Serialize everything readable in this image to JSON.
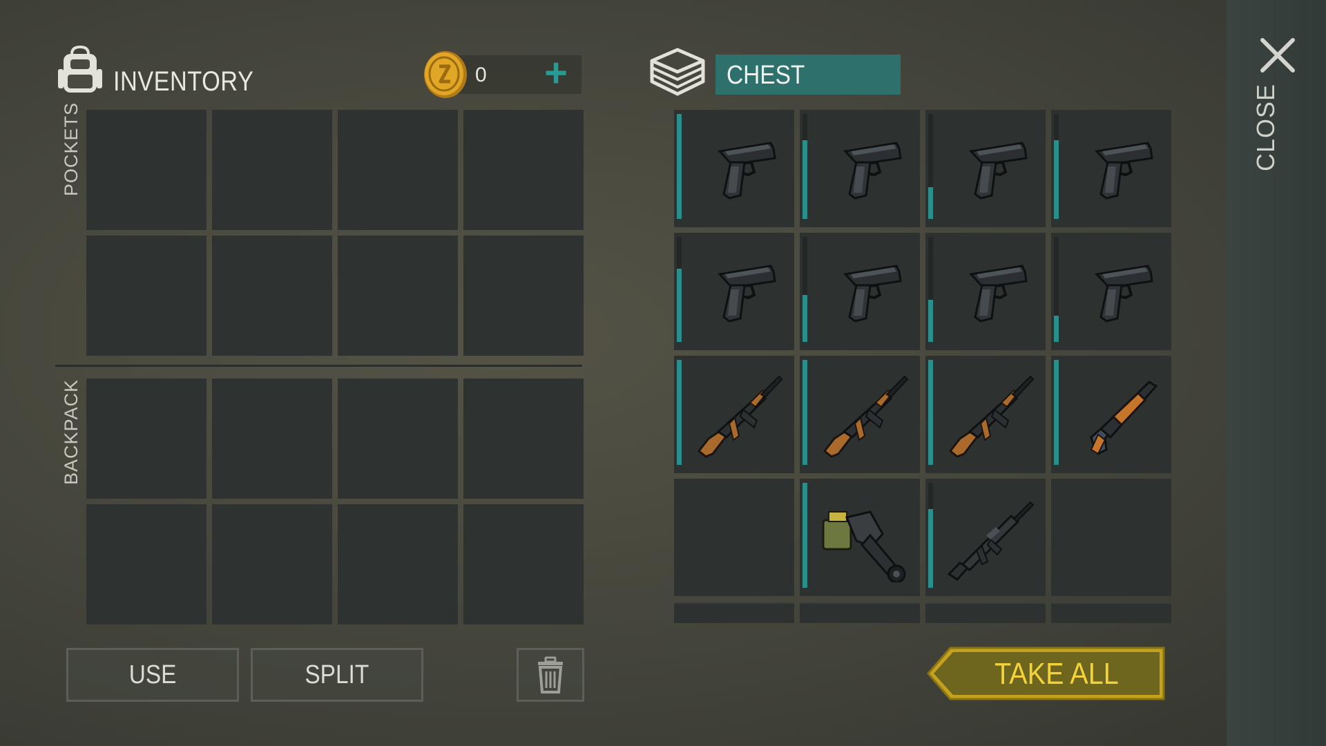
{
  "inventory": {
    "title": "INVENTORY",
    "coins": "0",
    "add_coins_symbol": "+",
    "pockets_label": "POCKETS",
    "backpack_label": "BACKPACK",
    "pockets_slots": 8,
    "backpack_slots": 8
  },
  "chest": {
    "title": "CHEST",
    "items": [
      {
        "name": "pistol",
        "icon": "pistol-icon",
        "condition": 1.0
      },
      {
        "name": "pistol",
        "icon": "pistol-icon",
        "condition": 0.75
      },
      {
        "name": "pistol",
        "icon": "pistol-icon",
        "condition": 0.3
      },
      {
        "name": "pistol",
        "icon": "pistol-icon",
        "condition": 0.75
      },
      {
        "name": "pistol",
        "icon": "pistol-icon",
        "condition": 0.7
      },
      {
        "name": "pistol",
        "icon": "pistol-icon",
        "condition": 0.45
      },
      {
        "name": "pistol",
        "icon": "pistol-icon",
        "condition": 0.4
      },
      {
        "name": "pistol",
        "icon": "pistol-icon",
        "condition": 0.25
      },
      {
        "name": "assault-rifle-laser",
        "icon": "assault-rifle-icon",
        "condition": 1.0
      },
      {
        "name": "assault-rifle",
        "icon": "assault-rifle-icon",
        "condition": 1.0
      },
      {
        "name": "assault-rifle",
        "icon": "assault-rifle-icon",
        "condition": 1.0
      },
      {
        "name": "shotgun",
        "icon": "shotgun-icon",
        "condition": 1.0
      },
      {
        "name": "empty",
        "icon": "",
        "condition": 0
      },
      {
        "name": "minigun",
        "icon": "minigun-icon",
        "condition": 1.0
      },
      {
        "name": "m16-rifle",
        "icon": "m16-rifle-icon",
        "condition": 0.75
      },
      {
        "name": "empty",
        "icon": "",
        "condition": 0
      }
    ]
  },
  "buttons": {
    "use": "USE",
    "split": "SPLIT",
    "take_all": "TAKE ALL",
    "close": "CLOSE"
  },
  "colors": {
    "accent_teal": "#2e706c",
    "condition_fill": "#2a8f8a",
    "take_all_gold": "#c2a21f",
    "take_all_text": "#f4d33a"
  }
}
